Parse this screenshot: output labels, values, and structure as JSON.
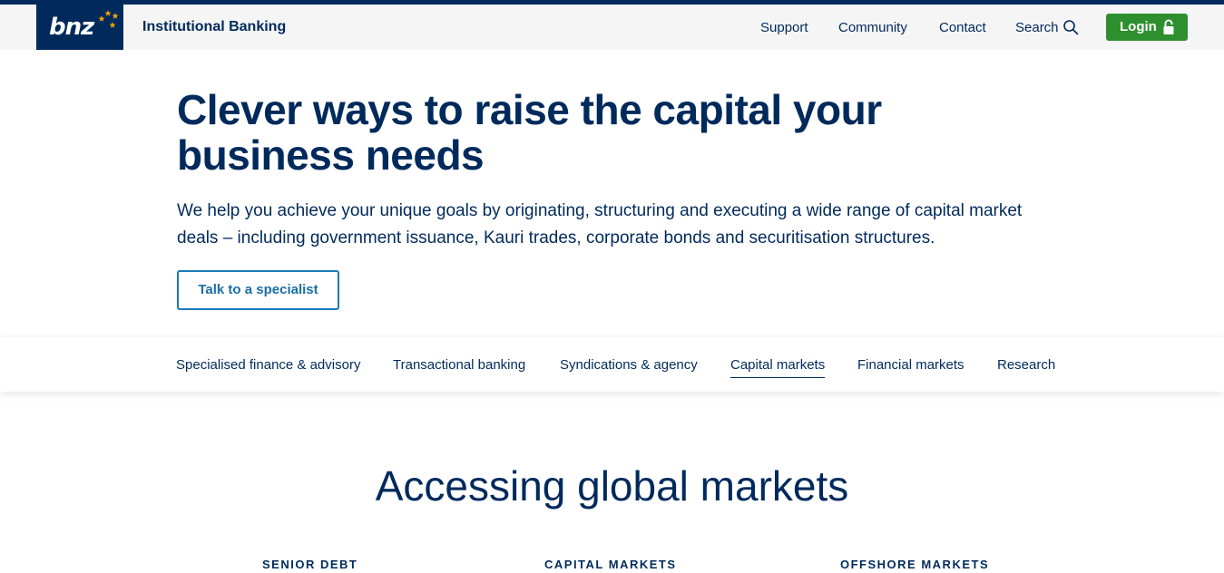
{
  "header": {
    "logo_text": "bnz",
    "brand": "Institutional Banking",
    "nav": [
      "Support",
      "Community",
      "Contact",
      "Search"
    ],
    "login_label": "Login"
  },
  "hero": {
    "title": "Clever ways to raise the capital your business needs",
    "description": "We help you achieve your unique goals by originating, structuring and executing a wide range of capital market deals – including government issuance, Kauri trades, corporate bonds and securitisation structures.",
    "cta_label": "Talk to a specialist"
  },
  "subnav": {
    "items": [
      "Specialised finance & advisory",
      "Transactional banking",
      "Syndications & agency",
      "Capital markets",
      "Financial markets",
      "Research"
    ],
    "active": "Capital markets"
  },
  "section": {
    "heading": "Accessing global markets",
    "columns": [
      "SENIOR DEBT",
      "CAPITAL MARKETS",
      "OFFSHORE MARKETS"
    ]
  },
  "colors": {
    "navy": "#002a5c",
    "login_green": "#2d8f2d",
    "cta_blue": "#1a7ab8",
    "star_gold": "#f5a800"
  },
  "icons": [
    "star-icon",
    "search-icon",
    "lock-icon"
  ]
}
